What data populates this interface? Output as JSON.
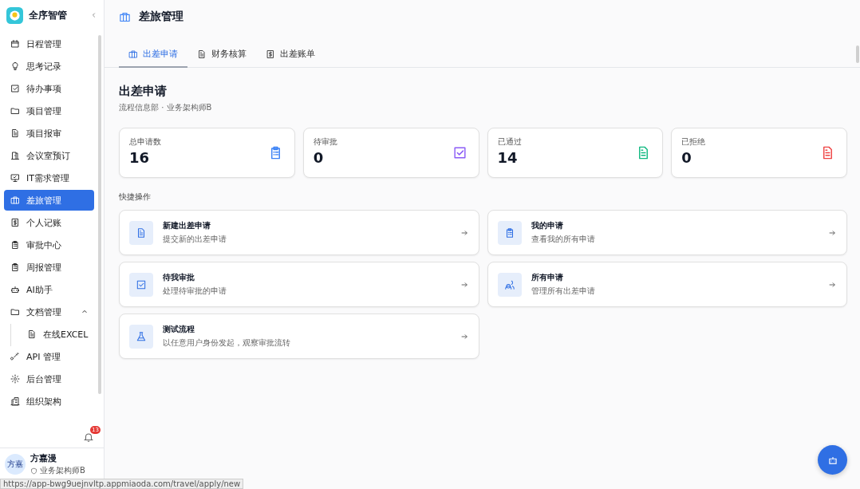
{
  "sidebar": {
    "app_name": "全序智管",
    "items": [
      {
        "label": "日程管理",
        "selected": false
      },
      {
        "label": "思考记录",
        "selected": false
      },
      {
        "label": "待办事项",
        "selected": false
      },
      {
        "label": "项目管理",
        "selected": false
      },
      {
        "label": "项目报审",
        "selected": false
      },
      {
        "label": "会议室预订",
        "selected": false
      },
      {
        "label": "IT需求管理",
        "selected": false
      },
      {
        "label": "差旅管理",
        "selected": true
      },
      {
        "label": "个人记账",
        "selected": false
      },
      {
        "label": "审批中心",
        "selected": false
      },
      {
        "label": "周报管理",
        "selected": false
      },
      {
        "label": "AI助手",
        "selected": false
      },
      {
        "label": "文档管理",
        "selected": false,
        "expanded": true,
        "children": [
          {
            "label": "在线EXCEL",
            "selected": false
          }
        ]
      },
      {
        "label": "API 管理",
        "selected": false
      },
      {
        "label": "后台管理",
        "selected": false
      },
      {
        "label": "组织架构",
        "selected": false
      }
    ],
    "notification_count": "13",
    "user": {
      "avatar": "方嘉",
      "name": "方嘉漫",
      "role": "业务架构师B"
    }
  },
  "header": {
    "title": "差旅管理"
  },
  "tabs": [
    {
      "label": "出差申请",
      "selected": true
    },
    {
      "label": "财务核算",
      "selected": false
    },
    {
      "label": "出差账单",
      "selected": false
    }
  ],
  "section": {
    "title": "出差申请",
    "subtitle": "流程信息部 · 业务架构师B"
  },
  "stats": [
    {
      "label": "总申请数",
      "value": "16",
      "color": "#3b82f6"
    },
    {
      "label": "待审批",
      "value": "0",
      "color": "#8b5cf6"
    },
    {
      "label": "已通过",
      "value": "14",
      "color": "#10b981"
    },
    {
      "label": "已拒绝",
      "value": "0",
      "color": "#ef4444"
    }
  ],
  "quick_actions": {
    "title": "快捷操作",
    "items": [
      {
        "title": "新建出差申请",
        "description": "提交新的出差申请"
      },
      {
        "title": "我的申请",
        "description": "查看我的所有申请"
      },
      {
        "title": "待我审批",
        "description": "处理待审批的申请"
      },
      {
        "title": "所有申请",
        "description": "管理所有出差申请"
      },
      {
        "title": "测试流程",
        "description": "以任意用户身份发起，观察审批流转"
      }
    ]
  },
  "status_url": "https://app-bwg9uejnvltp.appmiaoda.com/travel/apply/new"
}
